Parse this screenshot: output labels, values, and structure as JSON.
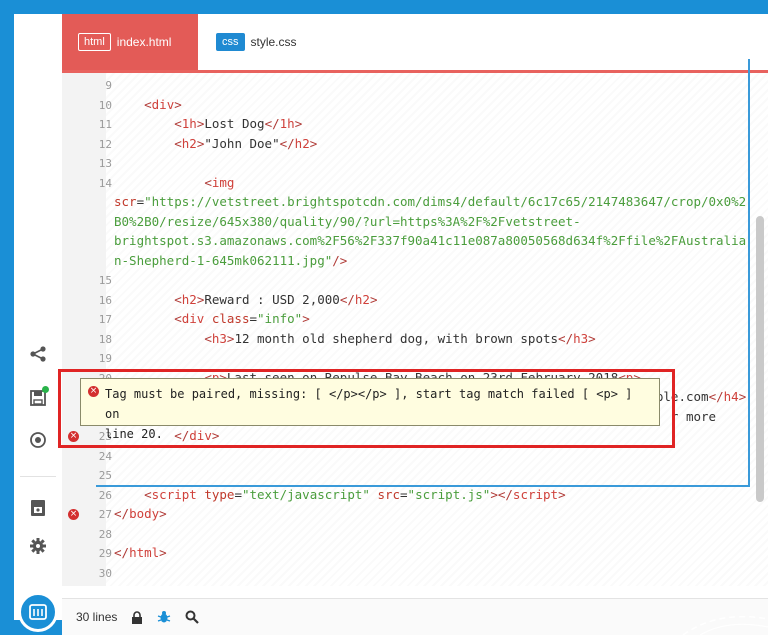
{
  "tabs": [
    {
      "badge": "html",
      "label": "index.html",
      "active": true
    },
    {
      "badge": "css",
      "label": "style.css",
      "active": false
    }
  ],
  "code_lines": [
    {
      "n": "9",
      "html": ""
    },
    {
      "n": "10",
      "html": "    <span class=\"br\">&lt;</span><span class=\"tag\">div</span><span class=\"br\">&gt;</span>"
    },
    {
      "n": "11",
      "html": "        <span class=\"br\">&lt;</span><span class=\"tag\">1h</span><span class=\"br\">&gt;</span>Lost Dog<span class=\"br\">&lt;/</span><span class=\"tag\">1h</span><span class=\"br\">&gt;</span>"
    },
    {
      "n": "12",
      "html": "        <span class=\"br\">&lt;</span><span class=\"tag\">h2</span><span class=\"br\">&gt;</span>\"John Doe\"<span class=\"br\">&lt;/</span><span class=\"tag\">h2</span><span class=\"br\">&gt;</span>"
    },
    {
      "n": "13",
      "html": ""
    },
    {
      "n": "14",
      "html": "            <span class=\"br\">&lt;</span><span class=\"tag\">img</span>"
    },
    {
      "n": "",
      "html": "<span class=\"attr\">scr</span>=<span class=\"str\">\"https://vetstreet.brightspotcdn.com/dims4/default/6c17c65/2147483647/crop/0x0%2</span>"
    },
    {
      "n": "",
      "html": "<span class=\"str\">B0%2B0/resize/645x380/quality/90/?url=https%3A%2F%2Fvetstreet-</span>"
    },
    {
      "n": "",
      "html": "<span class=\"str\">brightspot.s3.amazonaws.com%2F56%2F337f90a41c11e087a80050568d634f%2Ffile%2FAustralia</span>"
    },
    {
      "n": "",
      "html": "<span class=\"str\">n-Shepherd-1-645mk062111.jpg\"</span><span class=\"br\">/&gt;</span>"
    },
    {
      "n": "15",
      "html": ""
    },
    {
      "n": "16",
      "html": "        <span class=\"br\">&lt;</span><span class=\"tag\">h2</span><span class=\"br\">&gt;</span>Reward : USD 2,000<span class=\"br\">&lt;/</span><span class=\"tag\">h2</span><span class=\"br\">&gt;</span>"
    },
    {
      "n": "17",
      "html": "        <span class=\"br\">&lt;</span><span class=\"tag\">div</span> <span class=\"attr\">class</span>=<span class=\"str\">\"info\"</span><span class=\"br\">&gt;</span>"
    },
    {
      "n": "18",
      "html": "            <span class=\"br\">&lt;</span><span class=\"tag\">h3</span><span class=\"br\">&gt;</span>12 month old shepherd dog, with brown spots<span class=\"br\">&lt;/</span><span class=\"tag\">h3</span><span class=\"br\">&gt;</span>"
    },
    {
      "n": "19",
      "html": ""
    },
    {
      "n": "20",
      "html": "            <span class=\"br\">&lt;</span><span class=\"tag\">p</span><span class=\"br\">&gt;</span>Last seen on Repulse Bay Beach on 23rd February 2018<span class=\"br\">&lt;</span><span class=\"tag\">p</span><span class=\"br\">&gt;</span>"
    },
    {
      "n": "21",
      "html": "            <span class=\"br\">&lt;</span><span class=\"tag\">h4</span><span class=\"br\">&gt;</span> If found contact Mr. Smith: (852) 1555-5555 | info@example.com<span class=\"br\">&lt;/</span><span class=\"tag\">h4</span><span class=\"br\">&gt;</span>"
    },
    {
      "n": "22",
      "html": "                                                                          r more"
    },
    {
      "n": "23",
      "html": "        <span class=\"br\">&lt;/</span><span class=\"tag\">div</span><span class=\"br\">&gt;</span>"
    },
    {
      "n": "24",
      "html": ""
    },
    {
      "n": "25",
      "html": ""
    },
    {
      "n": "26",
      "html": "    <span class=\"br\">&lt;</span><span class=\"tag\">script</span> <span class=\"attr\">type</span>=<span class=\"str\">\"text/javascript\"</span> <span class=\"attr\">src</span>=<span class=\"str\">\"script.js\"</span><span class=\"br\">&gt;&lt;/</span><span class=\"tag\">script</span><span class=\"br\">&gt;</span>"
    },
    {
      "n": "27",
      "html": "<span class=\"br\">&lt;/</span><span class=\"tag\">body</span><span class=\"br\">&gt;</span>"
    },
    {
      "n": "28",
      "html": ""
    },
    {
      "n": "29",
      "html": "<span class=\"br\">&lt;/</span><span class=\"tag\">html</span><span class=\"br\">&gt;</span>"
    },
    {
      "n": "30",
      "html": ""
    }
  ],
  "error_tooltip": {
    "line1": "Tag must be paired, missing: [ </p></p> ], start tag match failed [ <p> ] on",
    "line2": "line 20."
  },
  "status": {
    "lines": "30 lines"
  },
  "colors": {
    "accent": "#e35b57",
    "frame": "#1a8fd6",
    "error": "#d32f2f",
    "highlight": "#e02424"
  }
}
